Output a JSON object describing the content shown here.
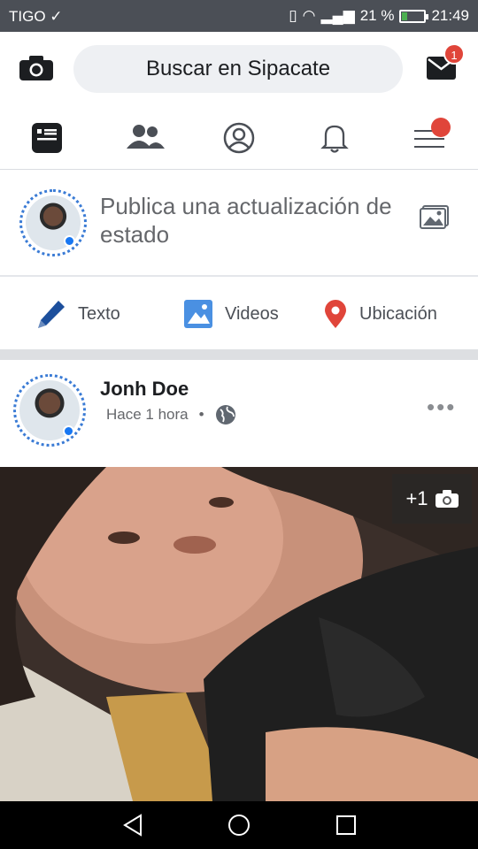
{
  "status_bar": {
    "carrier": "TIGO",
    "battery": "21 %",
    "battery_level": 0.21,
    "time": "21:49"
  },
  "top_bar": {
    "search_label": "Buscar en Sipacate",
    "messages_badge": "1"
  },
  "nav_tabs": [
    {
      "name": "news-feed",
      "active": true
    },
    {
      "name": "friends",
      "active": false
    },
    {
      "name": "profile",
      "active": false
    },
    {
      "name": "notifications",
      "active": false
    },
    {
      "name": "menu",
      "active": false
    }
  ],
  "composer": {
    "prompt": "Publica una actualización de estado"
  },
  "actions": [
    {
      "label": "Texto",
      "icon": "pencil-icon",
      "color": "#1c4f9c"
    },
    {
      "label": "Videos",
      "icon": "image-icon",
      "color": "#4a90e2"
    },
    {
      "label": "Ubicación",
      "icon": "location-pin-icon",
      "color": "#e0453a"
    }
  ],
  "post": {
    "author": "Jonh Doe",
    "time": "Hace 1 hora",
    "more_photos": "+1"
  },
  "colors": {
    "accent": "#1877f2",
    "badge": "#e0453a",
    "status_bar": "#4b4f56"
  }
}
